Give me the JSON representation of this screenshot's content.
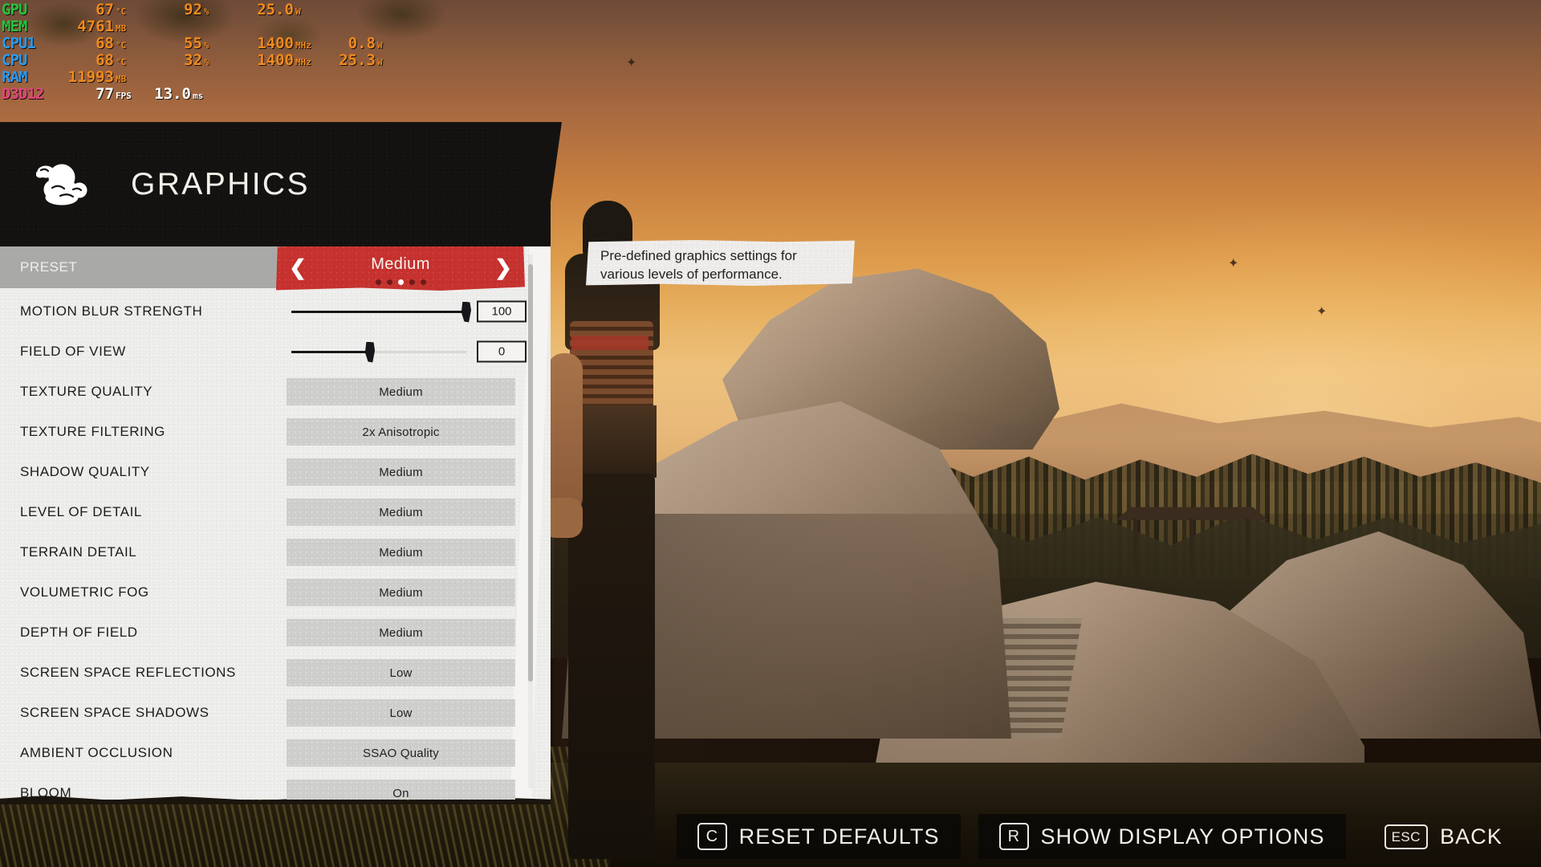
{
  "hw_overlay": {
    "rows": [
      {
        "label": "GPU",
        "color": "#27c23c",
        "cells": [
          {
            "value": "67",
            "unit": "°C"
          },
          {
            "value": "92",
            "unit": "%"
          },
          {
            "value": "25.0",
            "unit": "W"
          },
          {
            "value": "",
            "unit": ""
          }
        ]
      },
      {
        "label": "MEM",
        "color": "#27c23c",
        "cells": [
          {
            "value": "4761",
            "unit": "MB"
          },
          {
            "value": "",
            "unit": ""
          },
          {
            "value": "",
            "unit": ""
          },
          {
            "value": "",
            "unit": ""
          }
        ]
      },
      {
        "label": "CPU1",
        "color": "#2a9bf0",
        "cells": [
          {
            "value": "68",
            "unit": "°C"
          },
          {
            "value": "55",
            "unit": "%"
          },
          {
            "value": "1400",
            "unit": "MHz"
          },
          {
            "value": "0.8",
            "unit": "W"
          }
        ]
      },
      {
        "label": "CPU",
        "color": "#2a9bf0",
        "cells": [
          {
            "value": "68",
            "unit": "°C"
          },
          {
            "value": "32",
            "unit": "%"
          },
          {
            "value": "1400",
            "unit": "MHz"
          },
          {
            "value": "25.3",
            "unit": "W"
          }
        ]
      },
      {
        "label": "RAM",
        "color": "#2a9bf0",
        "cells": [
          {
            "value": "11993",
            "unit": "MB"
          },
          {
            "value": "",
            "unit": ""
          },
          {
            "value": "",
            "unit": ""
          },
          {
            "value": "",
            "unit": ""
          }
        ]
      },
      {
        "label": "D3D12",
        "color": "#e0457c",
        "cells": [
          {
            "value": "77",
            "unit": "FPS"
          },
          {
            "value": "13.0",
            "unit": "ms"
          },
          {
            "value": "",
            "unit": ""
          },
          {
            "value": "",
            "unit": ""
          }
        ]
      }
    ]
  },
  "panel": {
    "title": "GRAPHICS",
    "icon": "cloud-icon",
    "preset": {
      "label": "PRESET",
      "value": "Medium",
      "prev_icon": "chevron-left-icon",
      "next_icon": "chevron-right-icon",
      "dot_count": 5,
      "dot_active_index": 2,
      "accent_color": "#c8322f"
    },
    "sliders": [
      {
        "label": "MOTION BLUR STRENGTH",
        "value": "100",
        "percent": 100
      },
      {
        "label": "FIELD OF VIEW",
        "value": "0",
        "percent": 45
      }
    ],
    "options": [
      {
        "label": "TEXTURE QUALITY",
        "value": "Medium"
      },
      {
        "label": "TEXTURE FILTERING",
        "value": "2x Anisotropic"
      },
      {
        "label": "SHADOW QUALITY",
        "value": "Medium"
      },
      {
        "label": "LEVEL OF DETAIL",
        "value": "Medium"
      },
      {
        "label": "TERRAIN DETAIL",
        "value": "Medium"
      },
      {
        "label": "VOLUMETRIC FOG",
        "value": "Medium"
      },
      {
        "label": "DEPTH OF FIELD",
        "value": "Medium"
      },
      {
        "label": "SCREEN SPACE REFLECTIONS",
        "value": "Low"
      },
      {
        "label": "SCREEN SPACE SHADOWS",
        "value": "Low"
      },
      {
        "label": "AMBIENT OCCLUSION",
        "value": "SSAO Quality"
      },
      {
        "label": "BLOOM",
        "value": "On"
      }
    ]
  },
  "tooltip": {
    "line1": "Pre-defined graphics settings for",
    "line2": "various levels of performance."
  },
  "action_bar": {
    "actions": [
      {
        "key": "C",
        "label": "RESET DEFAULTS"
      },
      {
        "key": "R",
        "label": "SHOW DISPLAY OPTIONS"
      },
      {
        "key": "ESC",
        "label": "BACK"
      }
    ]
  }
}
